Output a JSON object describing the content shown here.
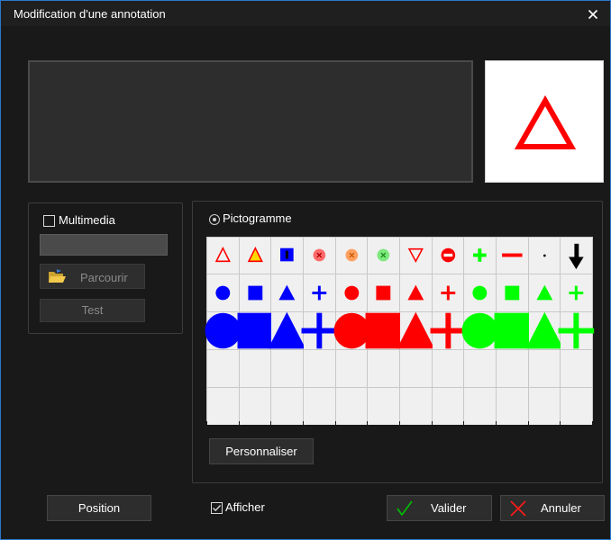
{
  "window": {
    "title": "Modification d'une annotation",
    "close_icon": "close-icon",
    "accent": "#2b78c9"
  },
  "preview": {
    "pictogram_icon": "red-triangle-outline-icon",
    "pictogram_color": "#ff0000"
  },
  "multimedia": {
    "label": "Multimedia",
    "checked": false,
    "file_value": "",
    "browse_label": "Parcourir",
    "browse_icon": "open-folder-icon",
    "test_label": "Test"
  },
  "pictogram": {
    "label": "Pictogramme",
    "selected": true,
    "grid": [
      [
        "red-triangle-outline-icon",
        "red-yellow-triangle-icon",
        "blue-square-black-bar-icon",
        "red-x-circle-icon",
        "orange-x-circle-icon",
        "green-x-circle-icon",
        "red-down-triangle-outline-icon",
        "no-entry-icon",
        "green-plus-icon",
        "red-minus-icon",
        "black-dot-icon",
        "black-down-arrow-icon"
      ],
      [
        "blue-circle-small-icon",
        "blue-square-small-icon",
        "blue-triangle-small-icon",
        "blue-plus-small-icon",
        "red-circle-small-icon",
        "red-square-small-icon",
        "red-triangle-small-icon",
        "red-plus-small-icon",
        "green-circle-small-icon",
        "green-square-small-icon",
        "green-triangle-small-icon",
        "green-plus-small-icon"
      ],
      [
        "blue-circle-large-icon",
        "blue-square-large-icon",
        "blue-triangle-large-icon",
        "blue-plus-large-icon",
        "red-circle-large-icon",
        "red-square-large-icon",
        "red-triangle-large-icon",
        "red-plus-large-icon",
        "green-circle-large-icon",
        "green-square-large-icon",
        "green-triangle-large-icon",
        "green-plus-large-icon"
      ]
    ],
    "empty_rows": 2,
    "colors": {
      "blue": "#0000ff",
      "red": "#ff0000",
      "green": "#00ff00",
      "black": "#000000",
      "orange": "#ffa060",
      "yellow": "#ffd800"
    },
    "customize_label": "Personnaliser"
  },
  "footer": {
    "position_label": "Position",
    "show_label": "Afficher",
    "show_checked": true,
    "validate_label": "Valider",
    "validate_icon": "green-check-icon",
    "cancel_label": "Annuler",
    "cancel_icon": "red-x-icon"
  }
}
